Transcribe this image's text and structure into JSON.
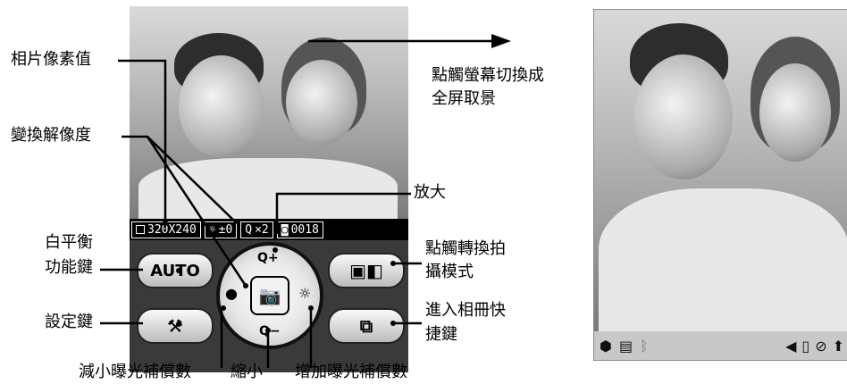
{
  "screen": {
    "status_bar": {
      "resolution": "320X240",
      "exposure": "±0",
      "zoom": "×2",
      "shots": "0018"
    },
    "buttons": {
      "wb_label": "AUTO"
    }
  },
  "annotations": {
    "pixel_value": "相片像素值",
    "fullscreen_line1": "點觸螢幕切換成",
    "fullscreen_line2": "全屏取景",
    "change_res": "變換解像度",
    "zoom_in": "放大",
    "wb_line1": "白平衡",
    "wb_line2": "功能鍵",
    "mode_line1": "點觸轉換拍",
    "mode_line2": "攝模式",
    "settings": "設定鍵",
    "album_line1": "進入相冊快",
    "album_line2": "捷鍵",
    "ev_minus": "減小曝光補償數",
    "zoom_out": "縮小",
    "ev_plus": "增加曝光補償數"
  },
  "icons": [
    "square-icon",
    "sun-icon",
    "magnifier-icon",
    "camera-counter-icon",
    "tools-icon",
    "camera-icon",
    "mode-switch-icon",
    "album-icon",
    "arrow-icon"
  ]
}
